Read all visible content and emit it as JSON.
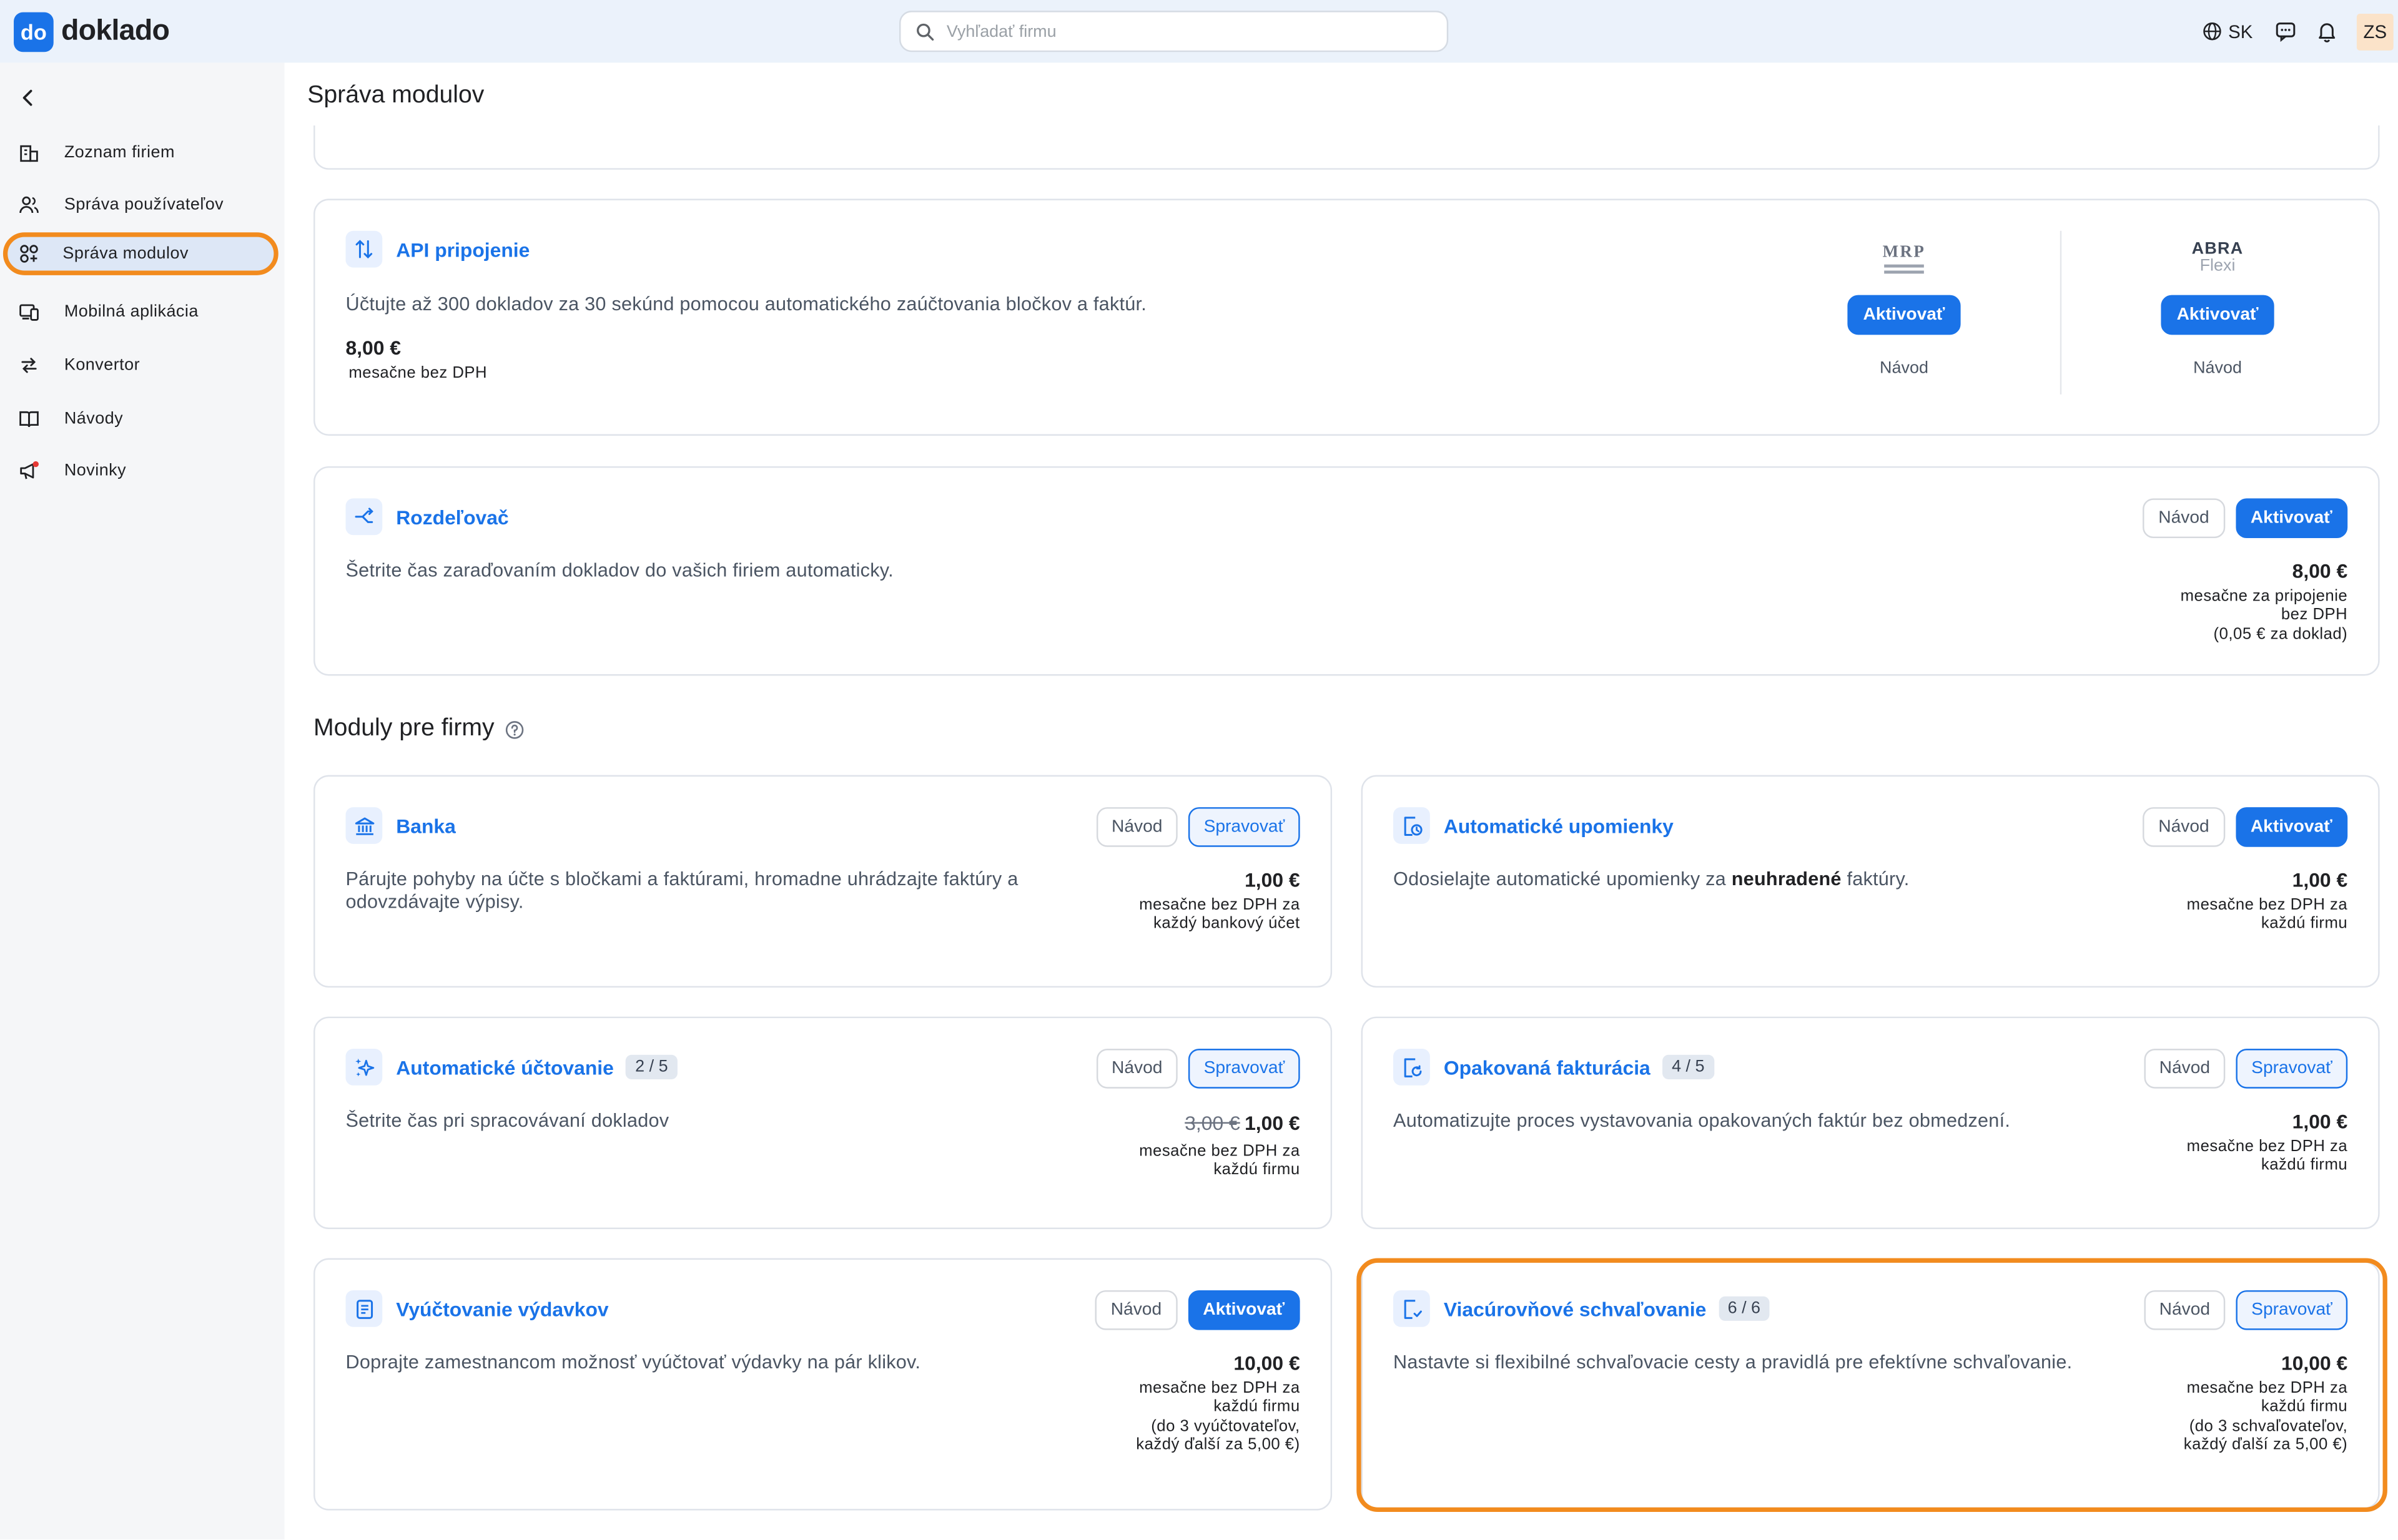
{
  "app": {
    "logo_mark": "do",
    "logo_text": "doklado"
  },
  "search": {
    "placeholder": "Vyhľadať firmu"
  },
  "topbar": {
    "language": "SK",
    "avatar": "ZS"
  },
  "sidebar": {
    "items": [
      {
        "label": "Zoznam firiem",
        "icon": "building-icon"
      },
      {
        "label": "Správa používateľov",
        "icon": "users-icon"
      },
      {
        "label": "Správa modulov",
        "icon": "modules-icon",
        "active": true
      },
      {
        "label": "Mobilná aplikácia",
        "icon": "devices-icon"
      },
      {
        "label": "Konvertor",
        "icon": "convert-icon"
      },
      {
        "label": "Návody",
        "icon": "book-icon"
      },
      {
        "label": "Novinky",
        "icon": "megaphone-icon"
      }
    ]
  },
  "page": {
    "title": "Správa modulov"
  },
  "api": {
    "title": "API pripojenie",
    "description": "Účtujte až 300 dokladov za 30 sekúnd pomocou automatického zaúčtovania bločkov a faktúr.",
    "price": "8,00 €",
    "price_note": "mesačne bez DPH",
    "partners": [
      {
        "logo_text": "MRP",
        "button": "Aktivovať",
        "link": "Návod"
      },
      {
        "logo_line1": "ABRA",
        "logo_line2": "Flexi",
        "button": "Aktivovať",
        "link": "Návod"
      }
    ]
  },
  "rozdelovac": {
    "title": "Rozdeľovač",
    "description": "Šetrite čas zaraďovaním dokladov do vašich firiem automaticky.",
    "btn_guide": "Návod",
    "btn_action": "Aktivovať",
    "price": "8,00 €",
    "price_note_1": "mesačne za pripojenie",
    "price_note_2": "bez DPH",
    "price_note_3": "(0,05 € za doklad)"
  },
  "section": {
    "title": "Moduly pre firmy"
  },
  "modules": {
    "banka": {
      "title": "Banka",
      "description_1": "Párujte pohyby na účte s bločkami a faktúrami, hromadne uhrádzajte faktúry a",
      "description_2": "odovzdávajte výpisy.",
      "btn_guide": "Návod",
      "btn_action": "Spravovať",
      "price": "1,00 €",
      "note_1": "mesačne bez DPH za",
      "note_2": "každý bankový účet"
    },
    "upomienky": {
      "title": "Automatické upomienky",
      "description_1": "Odosielajte automatické upomienky za ",
      "description_bold": "neuhradené",
      "description_2": " faktúry.",
      "btn_guide": "Návod",
      "btn_action": "Aktivovať",
      "price": "1,00 €",
      "note_1": "mesačne bez DPH za",
      "note_2": "každú firmu"
    },
    "uctovanie": {
      "title": "Automatické účtovanie",
      "badge": "2 / 5",
      "description": "Šetrite čas pri spracovávaní dokladov",
      "btn_guide": "Návod",
      "btn_action": "Spravovať",
      "price_old": "3,00 €",
      "price": "1,00 €",
      "note_1": "mesačne bez DPH za",
      "note_2": "každú firmu"
    },
    "fakturacia": {
      "title": "Opakovaná fakturácia",
      "badge": "4 / 5",
      "description": "Automatizujte proces vystavovania opakovaných faktúr bez obmedzení.",
      "btn_guide": "Návod",
      "btn_action": "Spravovať",
      "price": "1,00 €",
      "note_1": "mesačne bez DPH za",
      "note_2": "každú firmu"
    },
    "vydavky": {
      "title": "Vyúčtovanie výdavkov",
      "description": "Doprajte zamestnancom možnosť vyúčtovať výdavky na pár klikov.",
      "btn_guide": "Návod",
      "btn_action": "Aktivovať",
      "price": "10,00 €",
      "note_1": "mesačne bez DPH za",
      "note_2": "každú firmu",
      "note_3": "(do 3 vyúčtovateľov,",
      "note_4": "každý ďalší za 5,00 €)"
    },
    "schvalovanie": {
      "title": "Viacúrovňové schvaľovanie",
      "badge": "6 / 6",
      "description": "Nastavte si flexibilné schvaľovacie cesty a pravidlá pre efektívne schvaľovanie.",
      "btn_guide": "Návod",
      "btn_action": "Spravovať",
      "price": "10,00 €",
      "note_1": "mesačne bez DPH za",
      "note_2": "každú firmu",
      "note_3": "(do 3 schvaľovateľov,",
      "note_4": "každý ďalší za 5,00 €)"
    }
  },
  "colors": {
    "accent": "#1a73e8",
    "highlight": "#f28b1e",
    "sidebar_bg": "#f5f6f8",
    "topbar_bg": "#ebf2fb"
  }
}
